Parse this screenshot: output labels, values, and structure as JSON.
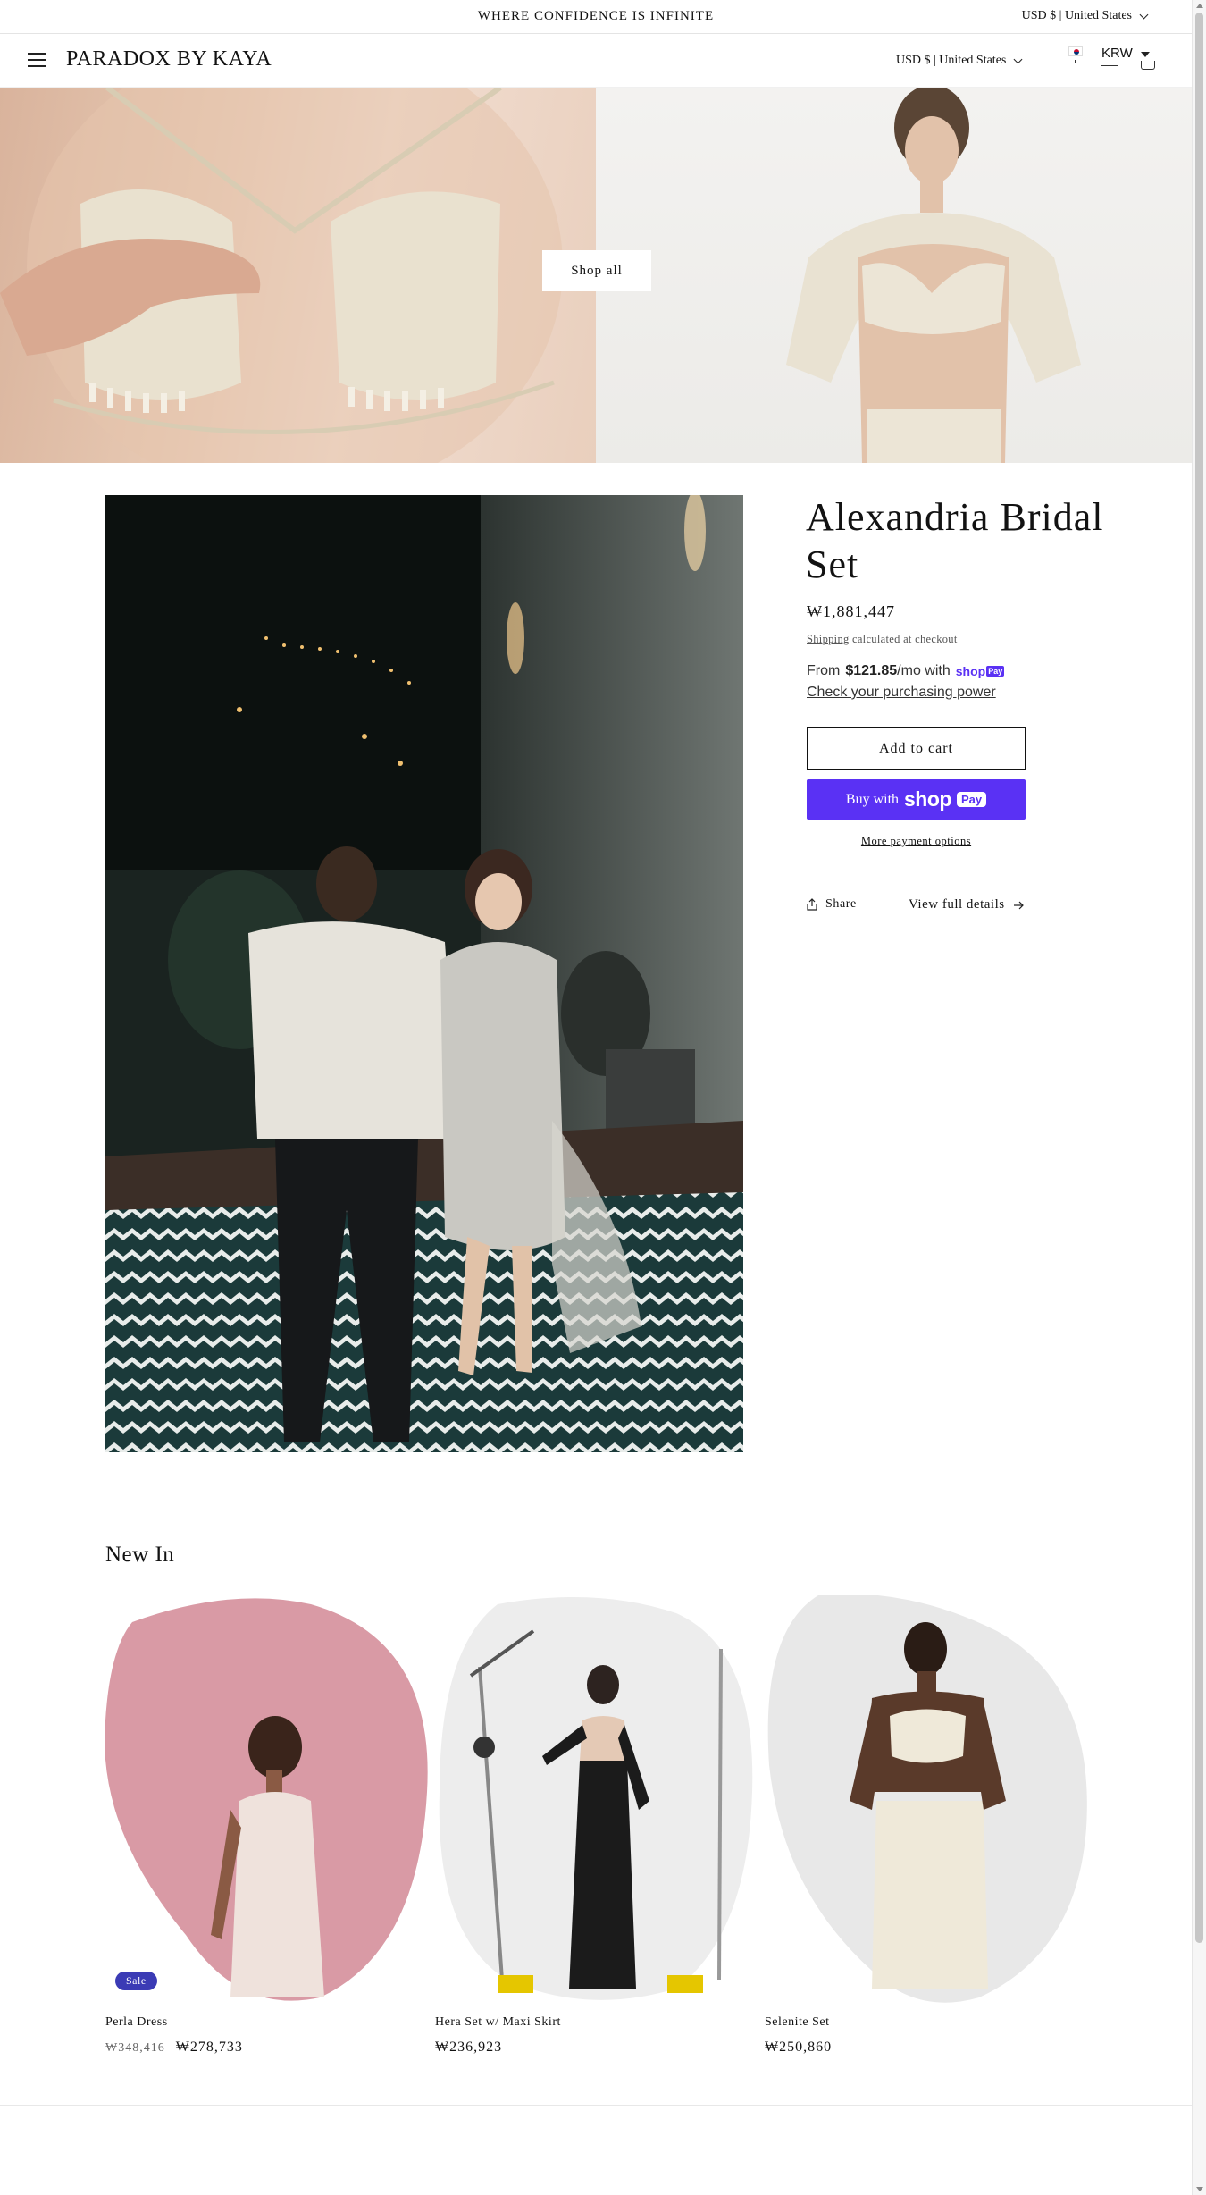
{
  "announcement": {
    "text": "WHERE CONFIDENCE IS INFINITE",
    "locale": "USD $ | United States"
  },
  "header": {
    "logo": "PARADOX BY KAYA",
    "locale": "USD $ | United States",
    "currency": "KRW",
    "menu_icon": "hamburger-menu-icon",
    "cart_icon": "cart-icon"
  },
  "hero": {
    "button_label": "Shop all"
  },
  "product": {
    "title": "Alexandria Bridal Set",
    "price": "₩1,881,447",
    "shipping_link": "Shipping",
    "shipping_text": " calculated at checkout",
    "installments_prefix": "From",
    "installments_amount": "$121.85",
    "installments_suffix": "/mo with",
    "shoppay_brand": "shop",
    "shoppay_pay": "Pay",
    "check_power": "Check your purchasing power",
    "add_to_cart": "Add to cart",
    "buy_with": "Buy with",
    "more_payment": "More payment options",
    "share": "Share",
    "view_full": "View full details"
  },
  "new_in": {
    "heading": "New In",
    "items": [
      {
        "name": "Perla Dress",
        "compare_price": "₩348,416",
        "price": "₩278,733",
        "badge": "Sale"
      },
      {
        "name": "Hera Set w/ Maxi Skirt",
        "price": "₩236,923"
      },
      {
        "name": "Selenite Set",
        "price": "₩250,860"
      }
    ]
  },
  "colors": {
    "shoppay_purple": "#5a31f4",
    "sale_badge": "#3b3bb5",
    "text": "#121212"
  }
}
